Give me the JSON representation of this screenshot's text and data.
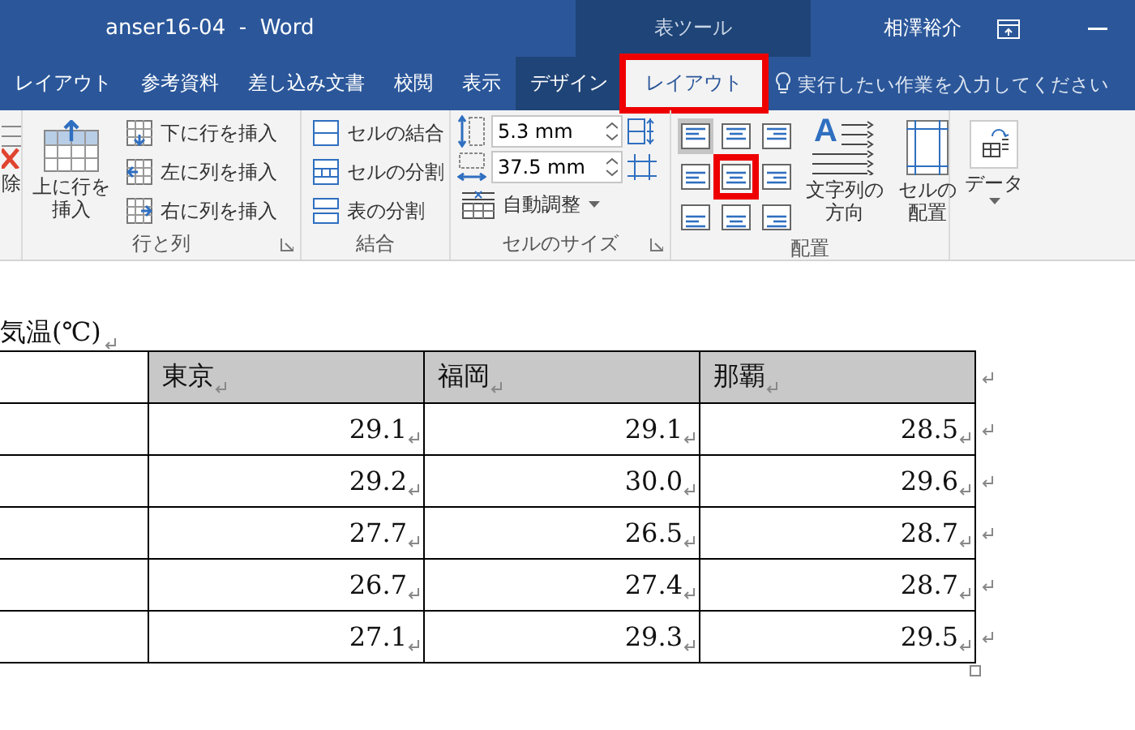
{
  "window": {
    "title": "anser16-04  -  Word",
    "context_label": "表ツール",
    "user": "相澤裕介"
  },
  "tabs": [
    {
      "label": "レイアウト",
      "selected": false,
      "contextual": false,
      "highlighted": false
    },
    {
      "label": "参考資料",
      "selected": false,
      "contextual": false,
      "highlighted": false
    },
    {
      "label": "差し込み文書",
      "selected": false,
      "contextual": false,
      "highlighted": false
    },
    {
      "label": "校閲",
      "selected": false,
      "contextual": false,
      "highlighted": false
    },
    {
      "label": "表示",
      "selected": false,
      "contextual": false,
      "highlighted": false
    },
    {
      "label": "デザイン",
      "selected": false,
      "contextual": true,
      "highlighted": false
    },
    {
      "label": "レイアウト",
      "selected": true,
      "contextual": true,
      "highlighted": true
    }
  ],
  "tell_me": {
    "placeholder": "実行したい作業を入力してください"
  },
  "ribbon": {
    "groups": [
      {
        "kind": "partial",
        "items": [
          {
            "kind": "delete",
            "label": "除"
          }
        ]
      },
      {
        "kind": "rows",
        "label": "行と列",
        "launcher": true,
        "items": [
          {
            "kind": "large",
            "label": "上に行を挿入"
          },
          {
            "kind": "small",
            "label": "下に行を挿入"
          },
          {
            "kind": "small",
            "label": "左に列を挿入"
          },
          {
            "kind": "small",
            "label": "右に列を挿入"
          }
        ]
      },
      {
        "kind": "merge",
        "label": "結合",
        "launcher": false,
        "items": [
          {
            "kind": "small",
            "label": "セルの結合"
          },
          {
            "kind": "small",
            "label": "セルの分割"
          },
          {
            "kind": "small",
            "label": "表の分割"
          }
        ]
      },
      {
        "kind": "size",
        "label": "セルのサイズ",
        "launcher": true,
        "items": [
          {
            "kind": "spinner",
            "value": "5.3 mm"
          },
          {
            "kind": "spinner",
            "value": "37.5 mm"
          },
          {
            "kind": "dropdown",
            "label": "自動調整"
          }
        ]
      },
      {
        "kind": "align",
        "label": "配置",
        "launcher": false,
        "alignment_buttons": [
          {
            "selected": true,
            "highlighted": false
          },
          {
            "selected": false,
            "highlighted": false
          },
          {
            "selected": false,
            "highlighted": false
          },
          {
            "selected": false,
            "highlighted": false
          },
          {
            "selected": false,
            "highlighted": true
          },
          {
            "selected": false,
            "highlighted": false
          },
          {
            "selected": false,
            "highlighted": false
          },
          {
            "selected": false,
            "highlighted": false
          },
          {
            "selected": false,
            "highlighted": false
          }
        ],
        "items": [
          {
            "kind": "direction",
            "glyph": "A",
            "label": "文字列の方向"
          },
          {
            "kind": "margins",
            "label": "セルの配置"
          }
        ]
      },
      {
        "kind": "data",
        "items": [
          {
            "kind": "menu",
            "label": "データ"
          }
        ]
      }
    ]
  },
  "document": {
    "caption": "気温(℃)",
    "table": {
      "columns": [
        "東京",
        "福岡",
        "那覇"
      ],
      "rows": [
        {
          "cells": [
            "29.1",
            "29.1",
            "28.5"
          ]
        },
        {
          "cells": [
            "29.2",
            "30.0",
            "29.6"
          ]
        },
        {
          "cells": [
            "27.7",
            "26.5",
            "28.7"
          ]
        },
        {
          "cells": [
            "26.7",
            "27.4",
            "28.7"
          ]
        },
        {
          "cells": [
            "27.1",
            "29.3",
            "29.5"
          ]
        }
      ]
    }
  }
}
